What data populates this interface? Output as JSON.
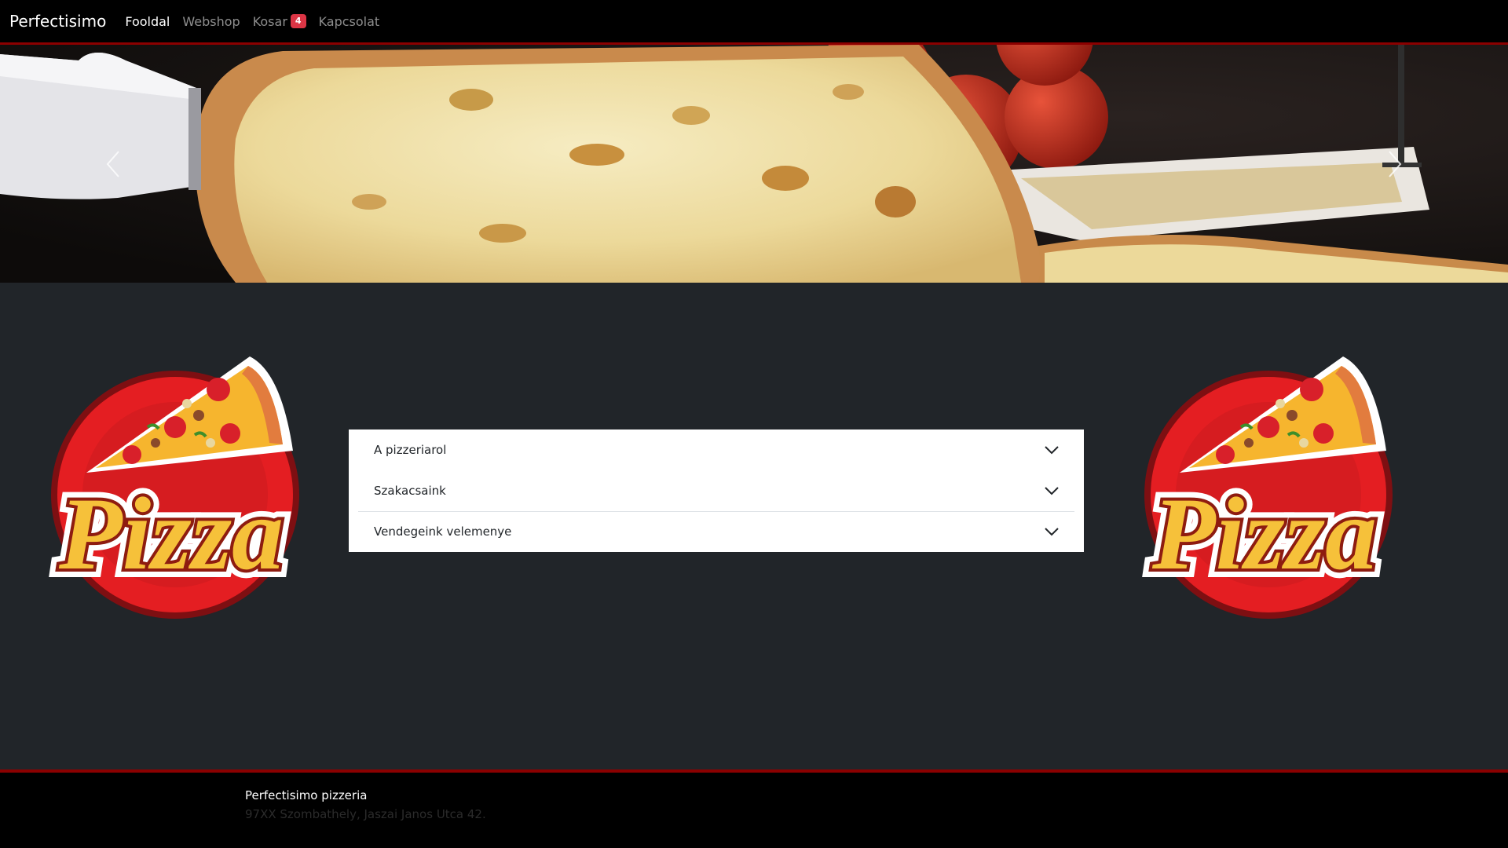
{
  "navbar": {
    "brand": "Perfectisimo",
    "links": [
      {
        "label": "Fooldal",
        "active": true
      },
      {
        "label": "Webshop",
        "active": false
      },
      {
        "label": "Kosar",
        "active": false,
        "badge": "4"
      },
      {
        "label": "Kapcsolat",
        "active": false
      }
    ]
  },
  "carousel": {
    "prev_icon": "chevron-left-icon",
    "next_icon": "chevron-right-icon"
  },
  "logos": {
    "left_text": "Pizza",
    "right_text": "Pizza"
  },
  "accordion": {
    "items": [
      {
        "label": "A pizzeriarol"
      },
      {
        "label": "Szakacsaink"
      },
      {
        "label": "Vendegeink velemenye"
      }
    ]
  },
  "footer": {
    "title": "Perfectisimo pizzeria",
    "address": "97XX Szombathely, Jaszai Janos Utca 42."
  },
  "colors": {
    "navbar_bg": "#000000",
    "accent_border": "#8b0000",
    "main_bg": "#212529",
    "badge": "#dc3545"
  }
}
